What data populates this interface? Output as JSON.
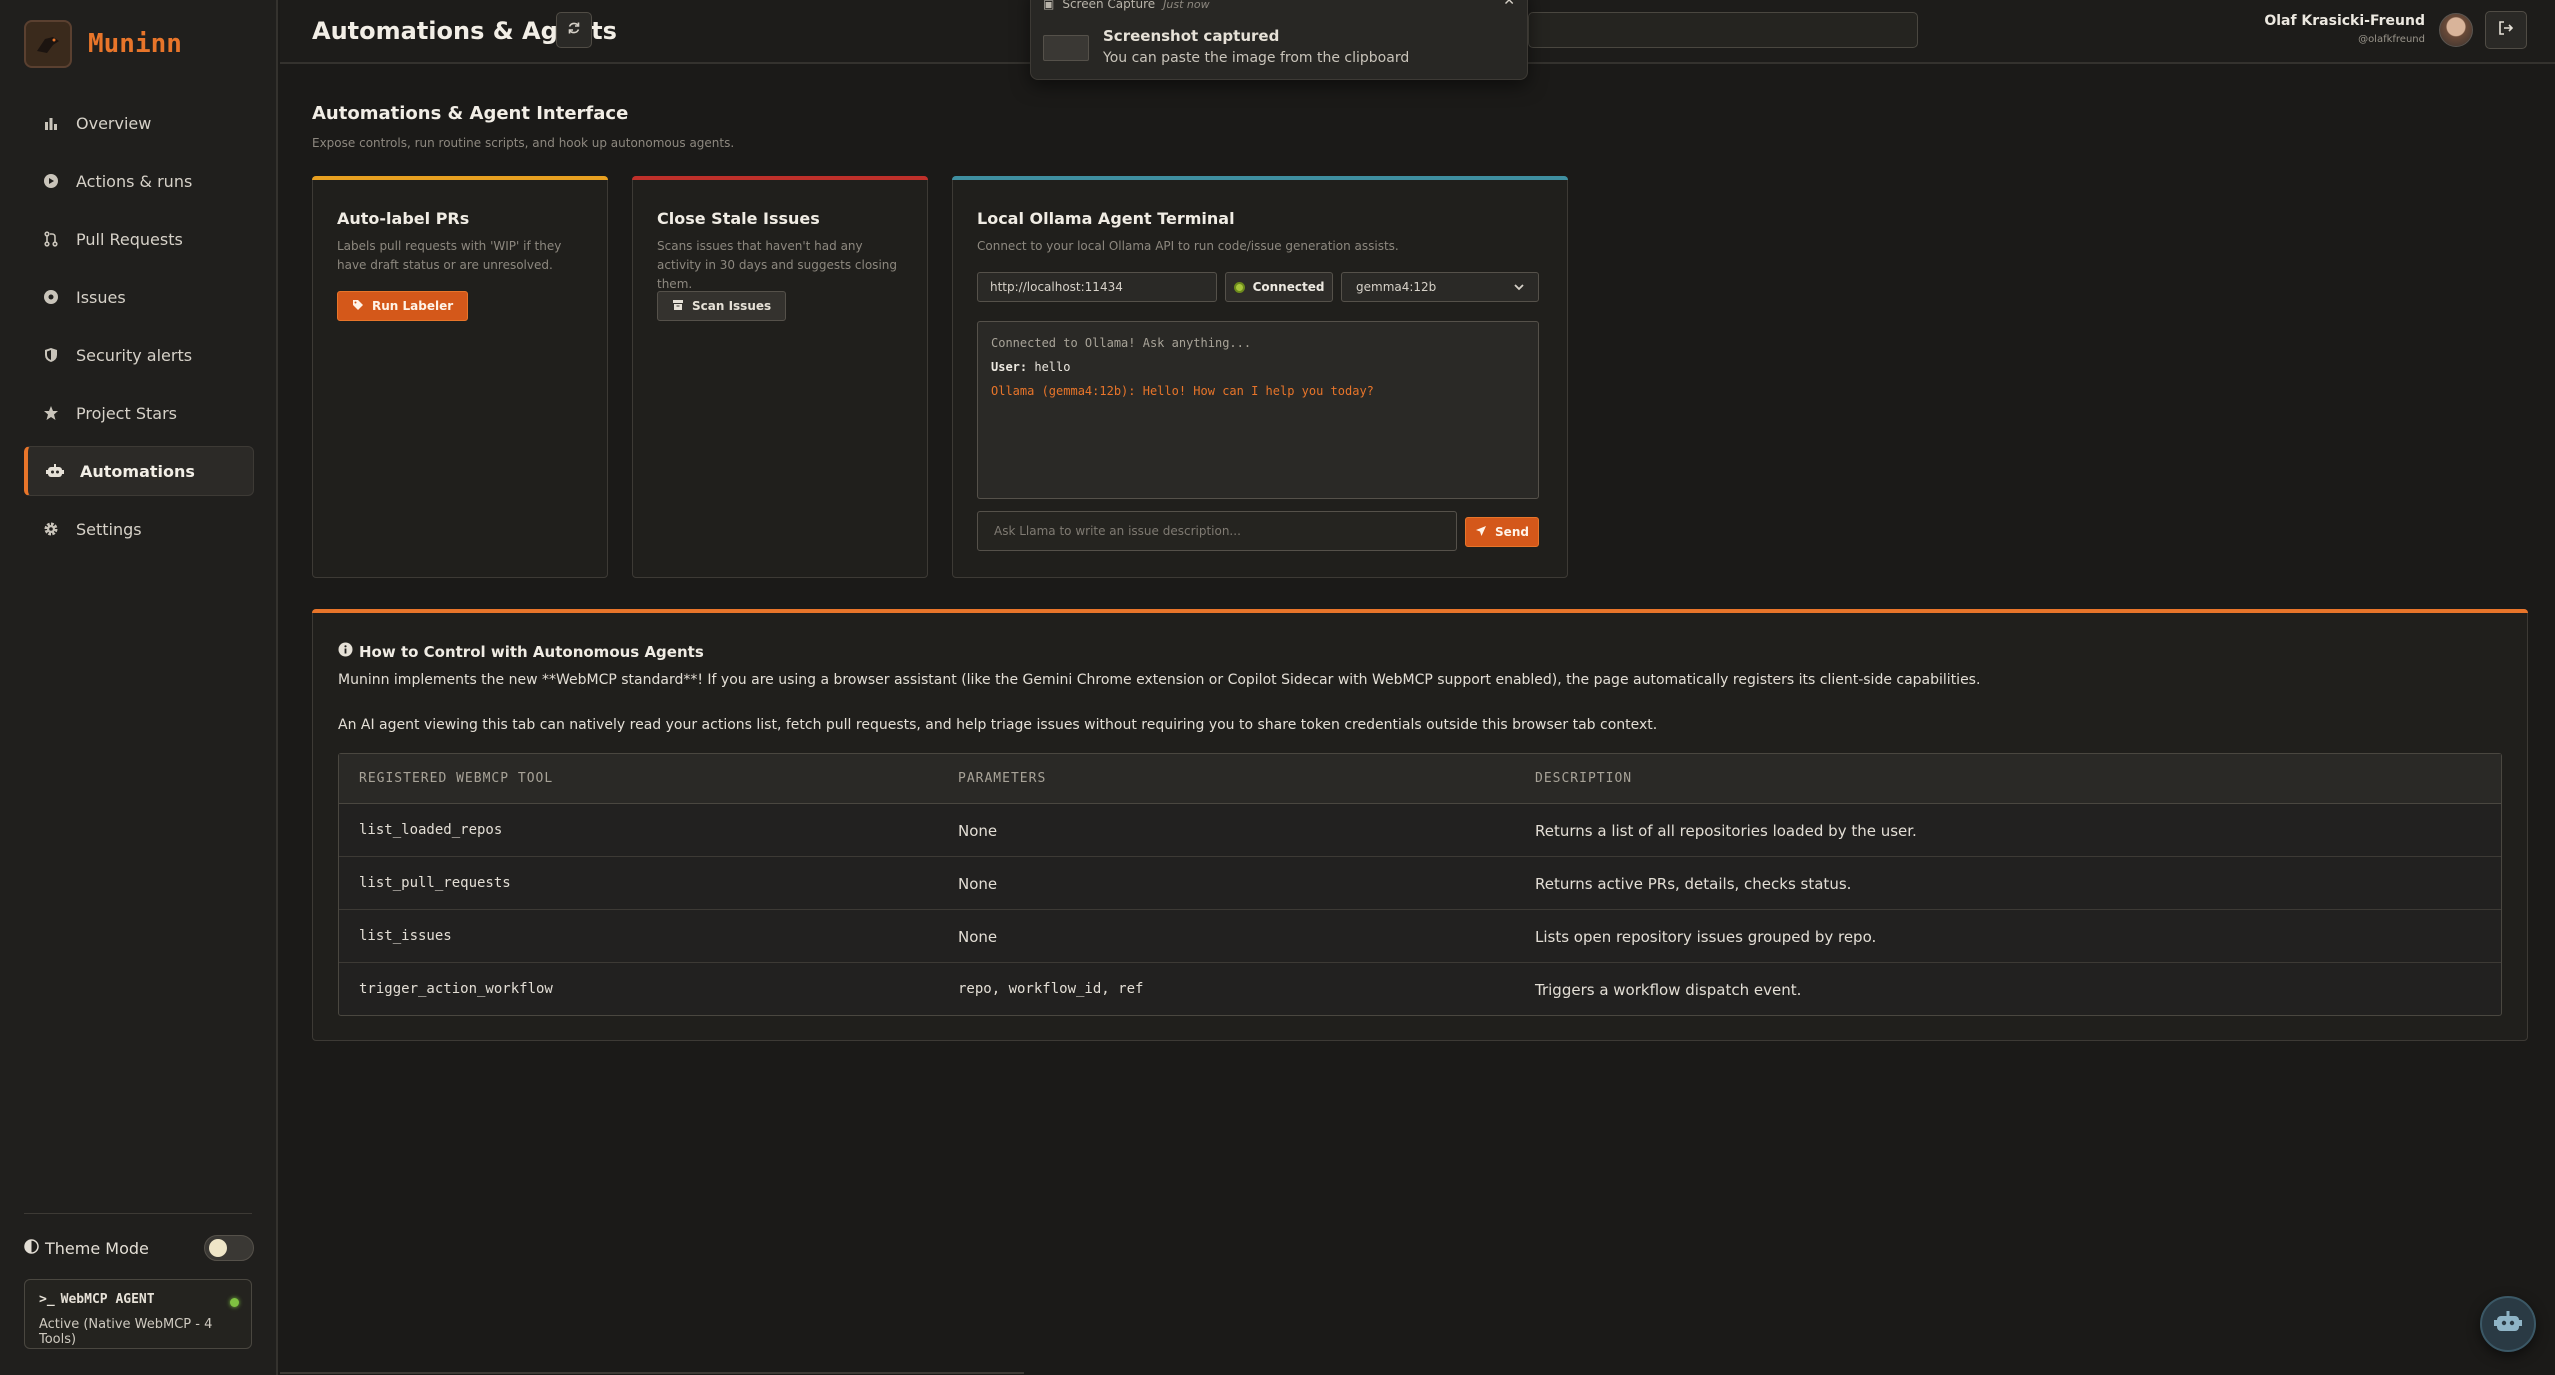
{
  "brand": {
    "name": "Muninn",
    "logo_text": "MUNINN"
  },
  "sidebar": {
    "items": [
      {
        "label": "Overview",
        "icon": "bar-chart-icon"
      },
      {
        "label": "Actions & runs",
        "icon": "play-circle-icon"
      },
      {
        "label": "Pull Requests",
        "icon": "git-pull-request-icon"
      },
      {
        "label": "Issues",
        "icon": "issue-dot-icon"
      },
      {
        "label": "Security alerts",
        "icon": "shield-icon"
      },
      {
        "label": "Project Stars",
        "icon": "star-icon"
      },
      {
        "label": "Automations",
        "icon": "robot-icon",
        "active": true
      },
      {
        "label": "Settings",
        "icon": "gear-icon"
      }
    ],
    "theme_label": "Theme Mode",
    "agent": {
      "title": "WebMCP AGENT",
      "status": "Active (Native WebMCP - 4 Tools)"
    }
  },
  "header": {
    "title": "Automations & Agents",
    "user_name": "Olaf Krasicki-Freund",
    "user_handle": "@olafkfreund"
  },
  "toast": {
    "app": "Screen Capture",
    "when": "Just now",
    "title": "Screenshot captured",
    "message": "You can paste the image from the clipboard"
  },
  "main": {
    "title": "Automations & Agent Interface",
    "subtitle": "Expose controls, run routine scripts, and hook up autonomous agents."
  },
  "cards": {
    "labeler": {
      "title": "Auto-label PRs",
      "desc": "Labels pull requests with 'WIP' if they have draft status or are unresolved.",
      "button": "Run Labeler"
    },
    "stale": {
      "title": "Close Stale Issues",
      "desc": "Scans issues that haven't had any activity in 30 days and suggests closing them.",
      "button": "Scan Issues"
    },
    "terminal": {
      "title": "Local Ollama Agent Terminal",
      "desc": "Connect to your local Ollama API to run code/issue generation assists.",
      "url": "http://localhost:11434",
      "status": "Connected",
      "model": "gemma4:12b",
      "log_system": "Connected to Ollama! Ask anything...",
      "log_user_prefix": "User:",
      "log_user_text": " hello",
      "log_ai": "Ollama (gemma4:12b): Hello! How can I help you today?",
      "placeholder": "Ask Llama to write an issue description...",
      "send": "Send"
    }
  },
  "colors": {
    "accent": "#e8752a",
    "card1_bar": "#e8a020",
    "card2_bar": "#c0302a",
    "card3_bar": "#3f8fa0"
  },
  "info": {
    "title": "How to Control with Autonomous Agents",
    "p1": "Muninn implements the new **WebMCP standard**! If you are using a browser assistant (like the Gemini Chrome extension or Copilot Sidecar with WebMCP support enabled), the page automatically registers its client-side capabilities.",
    "p2": "An AI agent viewing this tab can natively read your actions list, fetch pull requests, and help triage issues without requiring you to share token credentials outside this browser tab context.",
    "headers": [
      "REGISTERED WEBMCP TOOL",
      "PARAMETERS",
      "DESCRIPTION"
    ],
    "rows": [
      {
        "tool": "list_loaded_repos",
        "params": "None",
        "desc": "Returns a list of all repositories loaded by the user."
      },
      {
        "tool": "list_pull_requests",
        "params": "None",
        "desc": "Returns active PRs, details, checks status."
      },
      {
        "tool": "list_issues",
        "params": "None",
        "desc": "Lists open repository issues grouped by repo."
      },
      {
        "tool": "trigger_action_workflow",
        "params": "repo, workflow_id, ref",
        "desc": "Triggers a workflow dispatch event."
      }
    ]
  }
}
